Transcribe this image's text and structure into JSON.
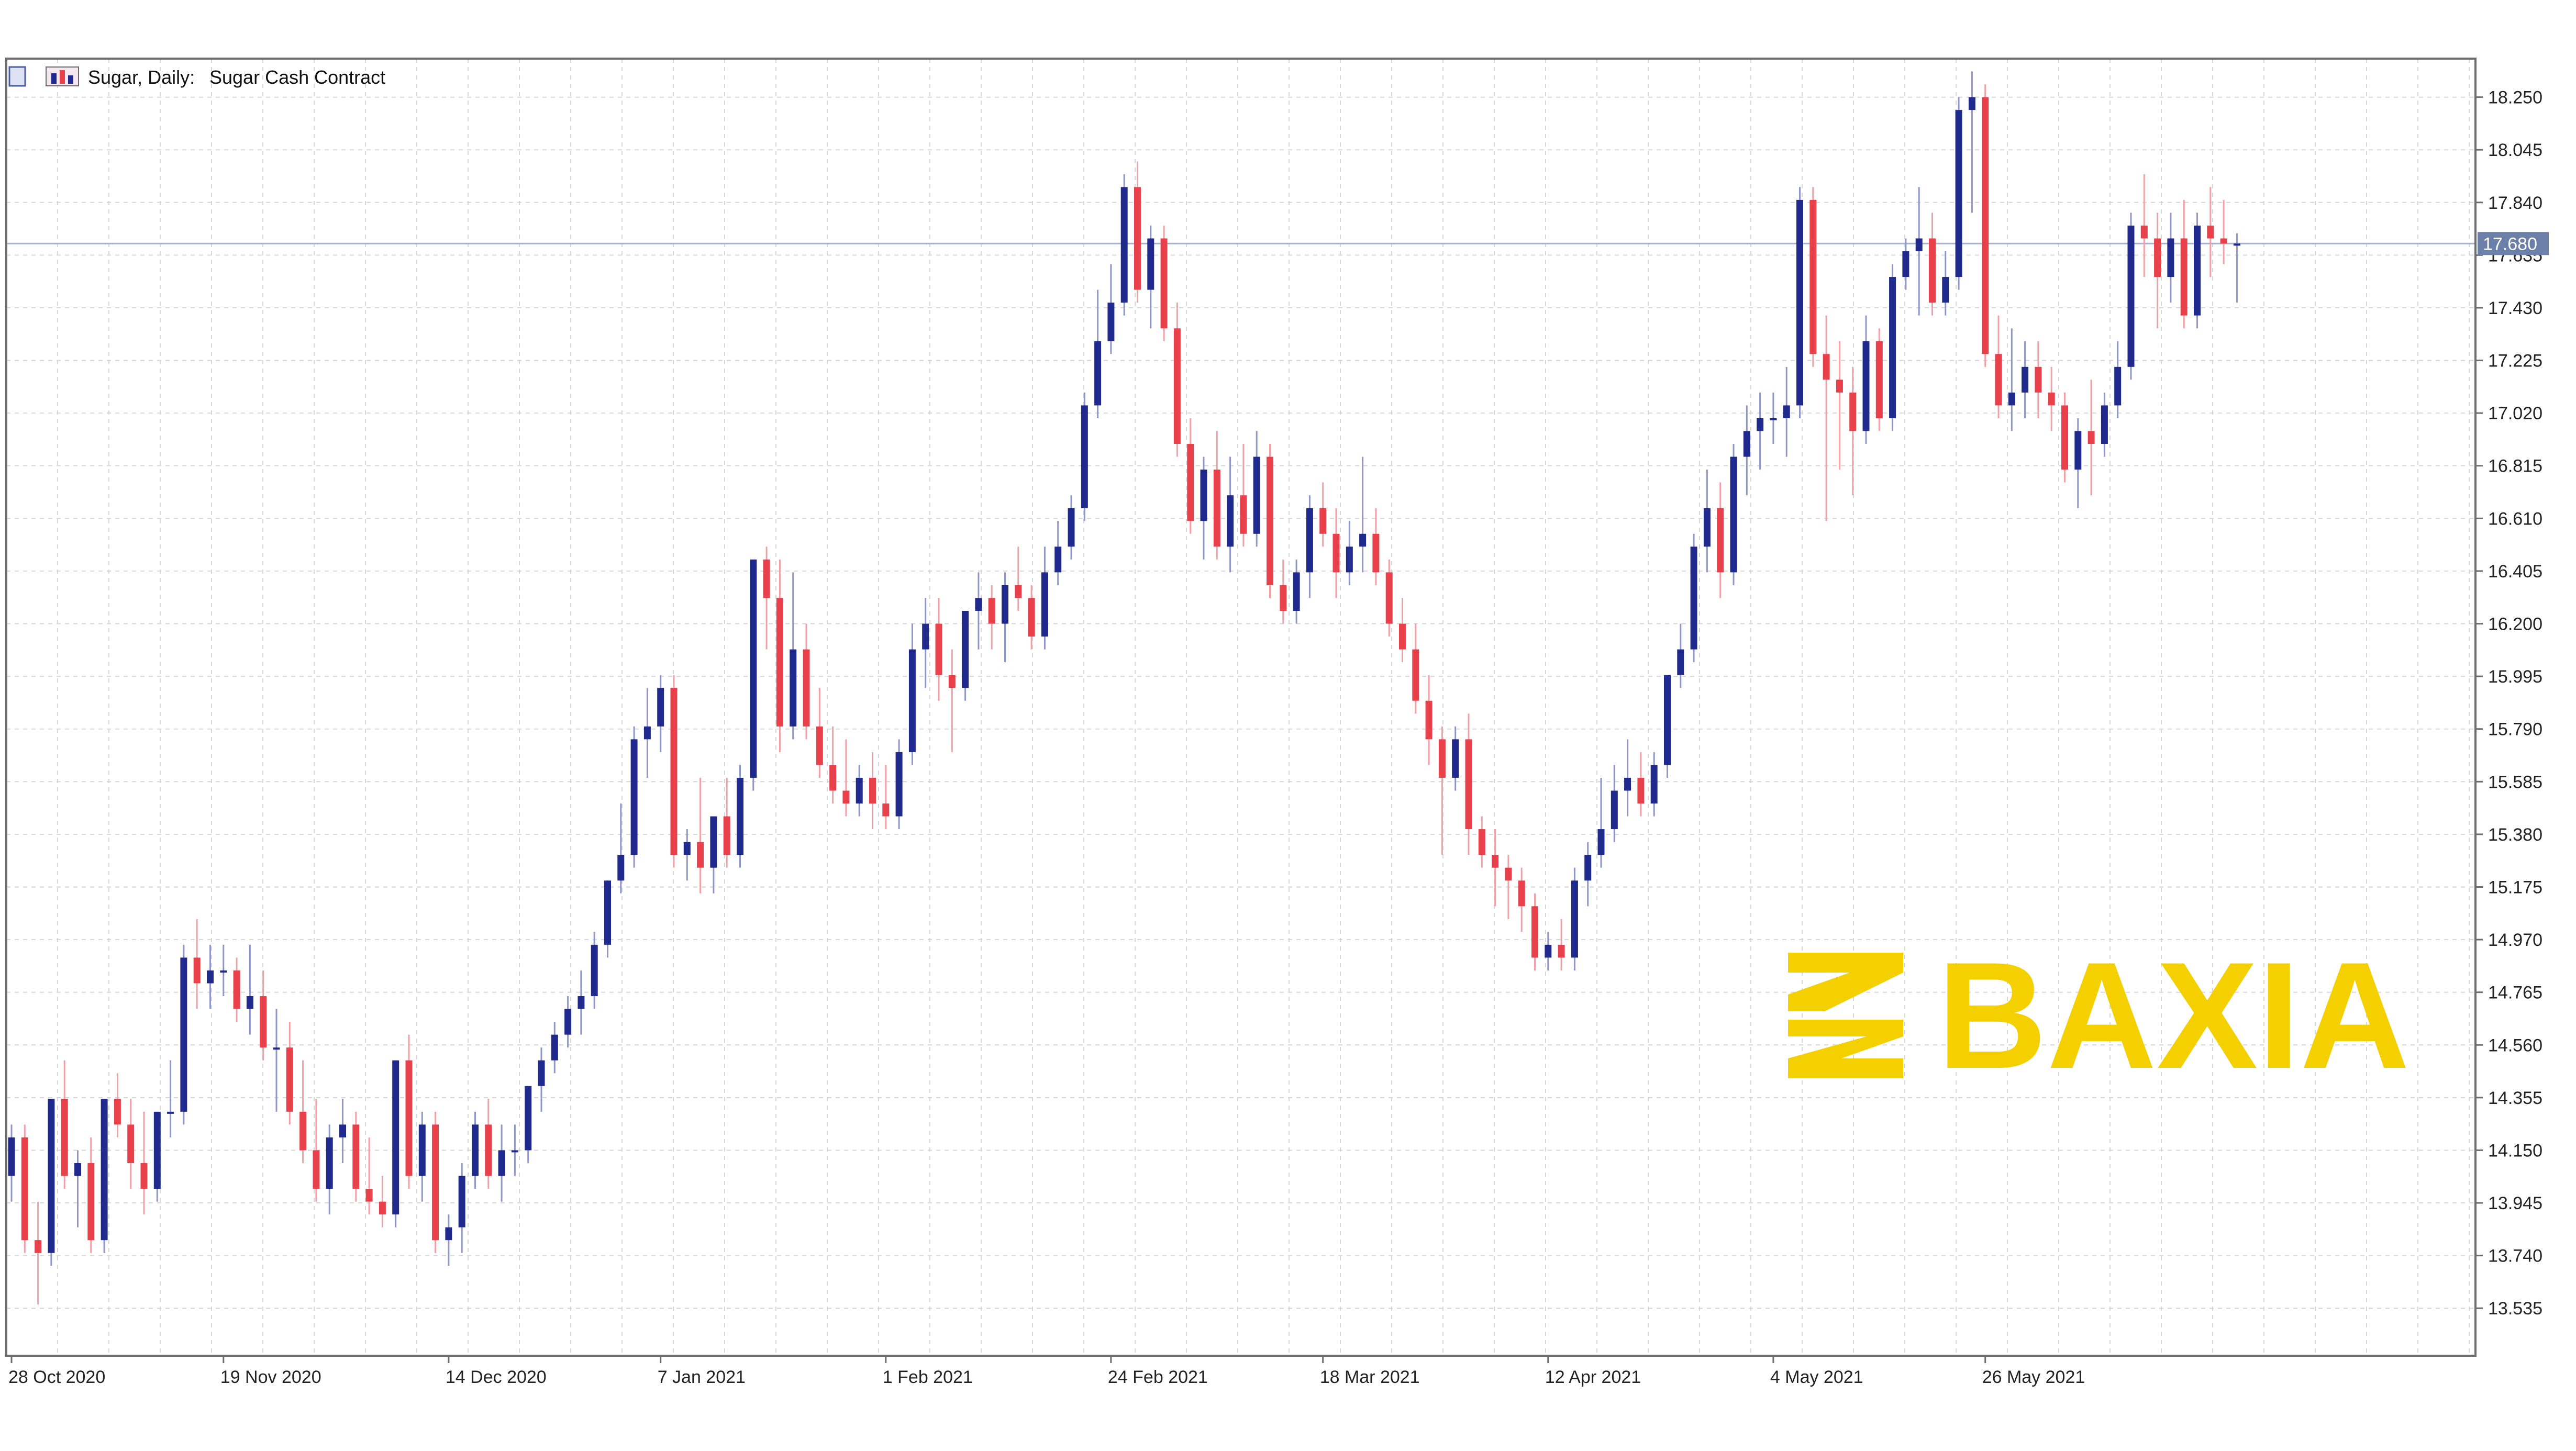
{
  "header": {
    "symbol_label": "Sugar, Daily:",
    "description": "Sugar Cash Contract"
  },
  "watermark": {
    "text": "BAXIA",
    "color": "#F5D000"
  },
  "colors": {
    "bull": "#1F2A8C",
    "bear": "#E8414C",
    "grid": "#D6D6D6",
    "axis": "#6E6E6E",
    "price_line": "#A8B4C8",
    "price_tag": "#6B7FA8"
  },
  "chart_data": {
    "type": "candlestick",
    "title": "Sugar, Daily:  Sugar Cash Contract",
    "ylim": [
      13.35,
      18.4
    ],
    "yticks": [
      18.25,
      18.045,
      17.84,
      17.635,
      17.43,
      17.225,
      17.02,
      16.815,
      16.61,
      16.405,
      16.2,
      15.995,
      15.79,
      15.585,
      15.38,
      15.175,
      14.97,
      14.765,
      14.56,
      14.355,
      14.15,
      13.945,
      13.74,
      13.535
    ],
    "ytick_labels": [
      "18.250",
      "18.045",
      "17.840",
      "17.635",
      "17.430",
      "17.225",
      "17.020",
      "16.815",
      "16.610",
      "16.405",
      "16.200",
      "15.995",
      "15.790",
      "15.585",
      "15.380",
      "15.175",
      "14.970",
      "14.765",
      "14.560",
      "14.355",
      "14.150",
      "13.945",
      "13.740",
      "13.535"
    ],
    "xtick_labels": [
      "28 Oct 2020",
      "19 Nov 2020",
      "14 Dec 2020",
      "7 Jan 2021",
      "1 Feb 2021",
      "24 Feb 2021",
      "18 Mar 2021",
      "12 Apr 2021",
      "4 May 2021",
      "26 May 2021"
    ],
    "xtick_bar_index": [
      0,
      16,
      33,
      49,
      66,
      83,
      99,
      116,
      133,
      149
    ],
    "current_price": 17.68,
    "current_price_label": "17.680",
    "grid": true,
    "candles": [
      {
        "o": 14.05,
        "h": 14.25,
        "l": 13.95,
        "c": 14.2
      },
      {
        "o": 14.2,
        "h": 14.25,
        "l": 13.75,
        "c": 13.8
      },
      {
        "o": 13.8,
        "h": 13.95,
        "l": 13.55,
        "c": 13.75
      },
      {
        "o": 13.75,
        "h": 14.35,
        "l": 13.7,
        "c": 14.35
      },
      {
        "o": 14.35,
        "h": 14.5,
        "l": 14.0,
        "c": 14.05
      },
      {
        "o": 14.05,
        "h": 14.15,
        "l": 13.85,
        "c": 14.1
      },
      {
        "o": 14.1,
        "h": 14.2,
        "l": 13.75,
        "c": 13.8
      },
      {
        "o": 13.8,
        "h": 14.35,
        "l": 13.75,
        "c": 14.35
      },
      {
        "o": 14.35,
        "h": 14.45,
        "l": 14.2,
        "c": 14.25
      },
      {
        "o": 14.25,
        "h": 14.35,
        "l": 14.0,
        "c": 14.1
      },
      {
        "o": 14.1,
        "h": 14.3,
        "l": 13.9,
        "c": 14.0
      },
      {
        "o": 14.0,
        "h": 14.3,
        "l": 13.95,
        "c": 14.3
      },
      {
        "o": 14.3,
        "h": 14.5,
        "l": 14.2,
        "c": 14.3
      },
      {
        "o": 14.3,
        "h": 14.95,
        "l": 14.25,
        "c": 14.9
      },
      {
        "o": 14.9,
        "h": 15.05,
        "l": 14.7,
        "c": 14.8
      },
      {
        "o": 14.8,
        "h": 14.95,
        "l": 14.7,
        "c": 14.85
      },
      {
        "o": 14.85,
        "h": 14.95,
        "l": 14.75,
        "c": 14.85
      },
      {
        "o": 14.85,
        "h": 14.9,
        "l": 14.65,
        "c": 14.7
      },
      {
        "o": 14.7,
        "h": 14.95,
        "l": 14.6,
        "c": 14.75
      },
      {
        "o": 14.75,
        "h": 14.85,
        "l": 14.5,
        "c": 14.55
      },
      {
        "o": 14.55,
        "h": 14.7,
        "l": 14.3,
        "c": 14.55
      },
      {
        "o": 14.55,
        "h": 14.65,
        "l": 14.25,
        "c": 14.3
      },
      {
        "o": 14.3,
        "h": 14.5,
        "l": 14.1,
        "c": 14.15
      },
      {
        "o": 14.15,
        "h": 14.35,
        "l": 13.95,
        "c": 14.0
      },
      {
        "o": 14.0,
        "h": 14.25,
        "l": 13.9,
        "c": 14.2
      },
      {
        "o": 14.2,
        "h": 14.35,
        "l": 14.1,
        "c": 14.25
      },
      {
        "o": 14.25,
        "h": 14.3,
        "l": 13.95,
        "c": 14.0
      },
      {
        "o": 14.0,
        "h": 14.2,
        "l": 13.9,
        "c": 13.95
      },
      {
        "o": 13.95,
        "h": 14.05,
        "l": 13.85,
        "c": 13.9
      },
      {
        "o": 13.9,
        "h": 14.5,
        "l": 13.85,
        "c": 14.5
      },
      {
        "o": 14.5,
        "h": 14.6,
        "l": 14.0,
        "c": 14.05
      },
      {
        "o": 14.05,
        "h": 14.3,
        "l": 13.95,
        "c": 14.25
      },
      {
        "o": 14.25,
        "h": 14.3,
        "l": 13.75,
        "c": 13.8
      },
      {
        "o": 13.8,
        "h": 13.9,
        "l": 13.7,
        "c": 13.85
      },
      {
        "o": 13.85,
        "h": 14.1,
        "l": 13.75,
        "c": 14.05
      },
      {
        "o": 14.05,
        "h": 14.3,
        "l": 14.0,
        "c": 14.25
      },
      {
        "o": 14.25,
        "h": 14.35,
        "l": 14.0,
        "c": 14.05
      },
      {
        "o": 14.05,
        "h": 14.25,
        "l": 13.95,
        "c": 14.15
      },
      {
        "o": 14.15,
        "h": 14.25,
        "l": 14.05,
        "c": 14.15
      },
      {
        "o": 14.15,
        "h": 14.4,
        "l": 14.1,
        "c": 14.4
      },
      {
        "o": 14.4,
        "h": 14.55,
        "l": 14.3,
        "c": 14.5
      },
      {
        "o": 14.5,
        "h": 14.65,
        "l": 14.45,
        "c": 14.6
      },
      {
        "o": 14.6,
        "h": 14.75,
        "l": 14.55,
        "c": 14.7
      },
      {
        "o": 14.7,
        "h": 14.85,
        "l": 14.6,
        "c": 14.75
      },
      {
        "o": 14.75,
        "h": 15.0,
        "l": 14.7,
        "c": 14.95
      },
      {
        "o": 14.95,
        "h": 15.2,
        "l": 14.9,
        "c": 15.2
      },
      {
        "o": 15.2,
        "h": 15.5,
        "l": 15.15,
        "c": 15.3
      },
      {
        "o": 15.3,
        "h": 15.8,
        "l": 15.25,
        "c": 15.75
      },
      {
        "o": 15.75,
        "h": 15.95,
        "l": 15.6,
        "c": 15.8
      },
      {
        "o": 15.8,
        "h": 16.0,
        "l": 15.7,
        "c": 15.95
      },
      {
        "o": 15.95,
        "h": 16.0,
        "l": 15.25,
        "c": 15.3
      },
      {
        "o": 15.3,
        "h": 15.4,
        "l": 15.2,
        "c": 15.35
      },
      {
        "o": 15.35,
        "h": 15.6,
        "l": 15.15,
        "c": 15.25
      },
      {
        "o": 15.25,
        "h": 15.45,
        "l": 15.15,
        "c": 15.45
      },
      {
        "o": 15.45,
        "h": 15.6,
        "l": 15.25,
        "c": 15.3
      },
      {
        "o": 15.3,
        "h": 15.65,
        "l": 15.25,
        "c": 15.6
      },
      {
        "o": 15.6,
        "h": 16.45,
        "l": 15.55,
        "c": 16.45
      },
      {
        "o": 16.45,
        "h": 16.5,
        "l": 16.1,
        "c": 16.3
      },
      {
        "o": 16.3,
        "h": 16.45,
        "l": 15.7,
        "c": 15.8
      },
      {
        "o": 15.8,
        "h": 16.4,
        "l": 15.75,
        "c": 16.1
      },
      {
        "o": 16.1,
        "h": 16.2,
        "l": 15.75,
        "c": 15.8
      },
      {
        "o": 15.8,
        "h": 15.95,
        "l": 15.6,
        "c": 15.65
      },
      {
        "o": 15.65,
        "h": 15.8,
        "l": 15.5,
        "c": 15.55
      },
      {
        "o": 15.55,
        "h": 15.75,
        "l": 15.45,
        "c": 15.5
      },
      {
        "o": 15.5,
        "h": 15.65,
        "l": 15.45,
        "c": 15.6
      },
      {
        "o": 15.6,
        "h": 15.7,
        "l": 15.4,
        "c": 15.5
      },
      {
        "o": 15.5,
        "h": 15.65,
        "l": 15.4,
        "c": 15.45
      },
      {
        "o": 15.45,
        "h": 15.75,
        "l": 15.4,
        "c": 15.7
      },
      {
        "o": 15.7,
        "h": 16.2,
        "l": 15.65,
        "c": 16.1
      },
      {
        "o": 16.1,
        "h": 16.3,
        "l": 15.95,
        "c": 16.2
      },
      {
        "o": 16.2,
        "h": 16.3,
        "l": 15.9,
        "c": 16.0
      },
      {
        "o": 16.0,
        "h": 16.1,
        "l": 15.7,
        "c": 15.95
      },
      {
        "o": 15.95,
        "h": 16.25,
        "l": 15.9,
        "c": 16.25
      },
      {
        "o": 16.25,
        "h": 16.4,
        "l": 16.1,
        "c": 16.3
      },
      {
        "o": 16.3,
        "h": 16.35,
        "l": 16.1,
        "c": 16.2
      },
      {
        "o": 16.2,
        "h": 16.4,
        "l": 16.05,
        "c": 16.35
      },
      {
        "o": 16.35,
        "h": 16.5,
        "l": 16.25,
        "c": 16.3
      },
      {
        "o": 16.3,
        "h": 16.35,
        "l": 16.1,
        "c": 16.15
      },
      {
        "o": 16.15,
        "h": 16.5,
        "l": 16.1,
        "c": 16.4
      },
      {
        "o": 16.4,
        "h": 16.6,
        "l": 16.35,
        "c": 16.5
      },
      {
        "o": 16.5,
        "h": 16.7,
        "l": 16.45,
        "c": 16.65
      },
      {
        "o": 16.65,
        "h": 17.1,
        "l": 16.6,
        "c": 17.05
      },
      {
        "o": 17.05,
        "h": 17.5,
        "l": 17.0,
        "c": 17.3
      },
      {
        "o": 17.3,
        "h": 17.6,
        "l": 17.25,
        "c": 17.45
      },
      {
        "o": 17.45,
        "h": 17.95,
        "l": 17.4,
        "c": 17.9
      },
      {
        "o": 17.9,
        "h": 18.0,
        "l": 17.45,
        "c": 17.5
      },
      {
        "o": 17.5,
        "h": 17.75,
        "l": 17.35,
        "c": 17.7
      },
      {
        "o": 17.7,
        "h": 17.75,
        "l": 17.3,
        "c": 17.35
      },
      {
        "o": 17.35,
        "h": 17.45,
        "l": 16.85,
        "c": 16.9
      },
      {
        "o": 16.9,
        "h": 17.0,
        "l": 16.55,
        "c": 16.6
      },
      {
        "o": 16.6,
        "h": 16.85,
        "l": 16.45,
        "c": 16.8
      },
      {
        "o": 16.8,
        "h": 16.95,
        "l": 16.45,
        "c": 16.5
      },
      {
        "o": 16.5,
        "h": 16.85,
        "l": 16.4,
        "c": 16.7
      },
      {
        "o": 16.7,
        "h": 16.9,
        "l": 16.5,
        "c": 16.55
      },
      {
        "o": 16.55,
        "h": 16.95,
        "l": 16.5,
        "c": 16.85
      },
      {
        "o": 16.85,
        "h": 16.9,
        "l": 16.3,
        "c": 16.35
      },
      {
        "o": 16.35,
        "h": 16.45,
        "l": 16.2,
        "c": 16.25
      },
      {
        "o": 16.25,
        "h": 16.45,
        "l": 16.2,
        "c": 16.4
      },
      {
        "o": 16.4,
        "h": 16.7,
        "l": 16.3,
        "c": 16.65
      },
      {
        "o": 16.65,
        "h": 16.75,
        "l": 16.5,
        "c": 16.55
      },
      {
        "o": 16.55,
        "h": 16.65,
        "l": 16.3,
        "c": 16.4
      },
      {
        "o": 16.4,
        "h": 16.6,
        "l": 16.35,
        "c": 16.5
      },
      {
        "o": 16.5,
        "h": 16.85,
        "l": 16.4,
        "c": 16.55
      },
      {
        "o": 16.55,
        "h": 16.65,
        "l": 16.35,
        "c": 16.4
      },
      {
        "o": 16.4,
        "h": 16.45,
        "l": 16.15,
        "c": 16.2
      },
      {
        "o": 16.2,
        "h": 16.3,
        "l": 16.05,
        "c": 16.1
      },
      {
        "o": 16.1,
        "h": 16.2,
        "l": 15.85,
        "c": 15.9
      },
      {
        "o": 15.9,
        "h": 16.0,
        "l": 15.65,
        "c": 15.75
      },
      {
        "o": 15.75,
        "h": 15.8,
        "l": 15.3,
        "c": 15.6
      },
      {
        "o": 15.6,
        "h": 15.8,
        "l": 15.55,
        "c": 15.75
      },
      {
        "o": 15.75,
        "h": 15.85,
        "l": 15.3,
        "c": 15.4
      },
      {
        "o": 15.4,
        "h": 15.45,
        "l": 15.25,
        "c": 15.3
      },
      {
        "o": 15.3,
        "h": 15.4,
        "l": 15.1,
        "c": 15.25
      },
      {
        "o": 15.25,
        "h": 15.3,
        "l": 15.05,
        "c": 15.2
      },
      {
        "o": 15.2,
        "h": 15.25,
        "l": 15.0,
        "c": 15.1
      },
      {
        "o": 15.1,
        "h": 15.15,
        "l": 14.85,
        "c": 14.9
      },
      {
        "o": 14.9,
        "h": 15.0,
        "l": 14.85,
        "c": 14.95
      },
      {
        "o": 14.95,
        "h": 15.05,
        "l": 14.85,
        "c": 14.9
      },
      {
        "o": 14.9,
        "h": 15.25,
        "l": 14.85,
        "c": 15.2
      },
      {
        "o": 15.2,
        "h": 15.35,
        "l": 15.1,
        "c": 15.3
      },
      {
        "o": 15.3,
        "h": 15.6,
        "l": 15.25,
        "c": 15.4
      },
      {
        "o": 15.4,
        "h": 15.65,
        "l": 15.35,
        "c": 15.55
      },
      {
        "o": 15.55,
        "h": 15.75,
        "l": 15.45,
        "c": 15.6
      },
      {
        "o": 15.6,
        "h": 15.7,
        "l": 15.45,
        "c": 15.5
      },
      {
        "o": 15.5,
        "h": 15.7,
        "l": 15.45,
        "c": 15.65
      },
      {
        "o": 15.65,
        "h": 16.0,
        "l": 15.6,
        "c": 16.0
      },
      {
        "o": 16.0,
        "h": 16.2,
        "l": 15.95,
        "c": 16.1
      },
      {
        "o": 16.1,
        "h": 16.55,
        "l": 16.05,
        "c": 16.5
      },
      {
        "o": 16.5,
        "h": 16.8,
        "l": 16.4,
        "c": 16.65
      },
      {
        "o": 16.65,
        "h": 16.75,
        "l": 16.3,
        "c": 16.4
      },
      {
        "o": 16.4,
        "h": 16.9,
        "l": 16.35,
        "c": 16.85
      },
      {
        "o": 16.85,
        "h": 17.05,
        "l": 16.7,
        "c": 16.95
      },
      {
        "o": 16.95,
        "h": 17.1,
        "l": 16.8,
        "c": 17.0
      },
      {
        "o": 17.0,
        "h": 17.1,
        "l": 16.9,
        "c": 17.0
      },
      {
        "o": 17.0,
        "h": 17.2,
        "l": 16.85,
        "c": 17.05
      },
      {
        "o": 17.05,
        "h": 17.9,
        "l": 17.0,
        "c": 17.85
      },
      {
        "o": 17.85,
        "h": 17.9,
        "l": 17.2,
        "c": 17.25
      },
      {
        "o": 17.25,
        "h": 17.4,
        "l": 16.6,
        "c": 17.15
      },
      {
        "o": 17.15,
        "h": 17.3,
        "l": 16.8,
        "c": 17.1
      },
      {
        "o": 17.1,
        "h": 17.2,
        "l": 16.7,
        "c": 16.95
      },
      {
        "o": 16.95,
        "h": 17.4,
        "l": 16.9,
        "c": 17.3
      },
      {
        "o": 17.3,
        "h": 17.35,
        "l": 16.95,
        "c": 17.0
      },
      {
        "o": 17.0,
        "h": 17.6,
        "l": 16.95,
        "c": 17.55
      },
      {
        "o": 17.55,
        "h": 17.7,
        "l": 17.5,
        "c": 17.65
      },
      {
        "o": 17.65,
        "h": 17.9,
        "l": 17.4,
        "c": 17.7
      },
      {
        "o": 17.7,
        "h": 17.8,
        "l": 17.4,
        "c": 17.45
      },
      {
        "o": 17.45,
        "h": 17.65,
        "l": 17.4,
        "c": 17.55
      },
      {
        "o": 17.55,
        "h": 18.25,
        "l": 17.5,
        "c": 18.2
      },
      {
        "o": 18.2,
        "h": 18.35,
        "l": 17.8,
        "c": 18.25
      },
      {
        "o": 18.25,
        "h": 18.3,
        "l": 17.2,
        "c": 17.25
      },
      {
        "o": 17.25,
        "h": 17.4,
        "l": 17.0,
        "c": 17.05
      },
      {
        "o": 17.05,
        "h": 17.35,
        "l": 16.95,
        "c": 17.1
      },
      {
        "o": 17.1,
        "h": 17.3,
        "l": 17.0,
        "c": 17.2
      },
      {
        "o": 17.2,
        "h": 17.3,
        "l": 17.0,
        "c": 17.1
      },
      {
        "o": 17.1,
        "h": 17.2,
        "l": 16.95,
        "c": 17.05
      },
      {
        "o": 17.05,
        "h": 17.1,
        "l": 16.75,
        "c": 16.8
      },
      {
        "o": 16.8,
        "h": 17.0,
        "l": 16.65,
        "c": 16.95
      },
      {
        "o": 16.95,
        "h": 17.15,
        "l": 16.7,
        "c": 16.9
      },
      {
        "o": 16.9,
        "h": 17.1,
        "l": 16.85,
        "c": 17.05
      },
      {
        "o": 17.05,
        "h": 17.3,
        "l": 17.0,
        "c": 17.2
      },
      {
        "o": 17.2,
        "h": 17.8,
        "l": 17.15,
        "c": 17.75
      },
      {
        "o": 17.75,
        "h": 17.95,
        "l": 17.55,
        "c": 17.7
      },
      {
        "o": 17.7,
        "h": 17.8,
        "l": 17.35,
        "c": 17.55
      },
      {
        "o": 17.55,
        "h": 17.8,
        "l": 17.45,
        "c": 17.7
      },
      {
        "o": 17.7,
        "h": 17.85,
        "l": 17.35,
        "c": 17.4
      },
      {
        "o": 17.4,
        "h": 17.8,
        "l": 17.35,
        "c": 17.75
      },
      {
        "o": 17.75,
        "h": 17.9,
        "l": 17.55,
        "c": 17.7
      },
      {
        "o": 17.7,
        "h": 17.85,
        "l": 17.6,
        "c": 17.68
      },
      {
        "o": 17.68,
        "h": 17.72,
        "l": 17.45,
        "c": 17.68
      }
    ]
  }
}
